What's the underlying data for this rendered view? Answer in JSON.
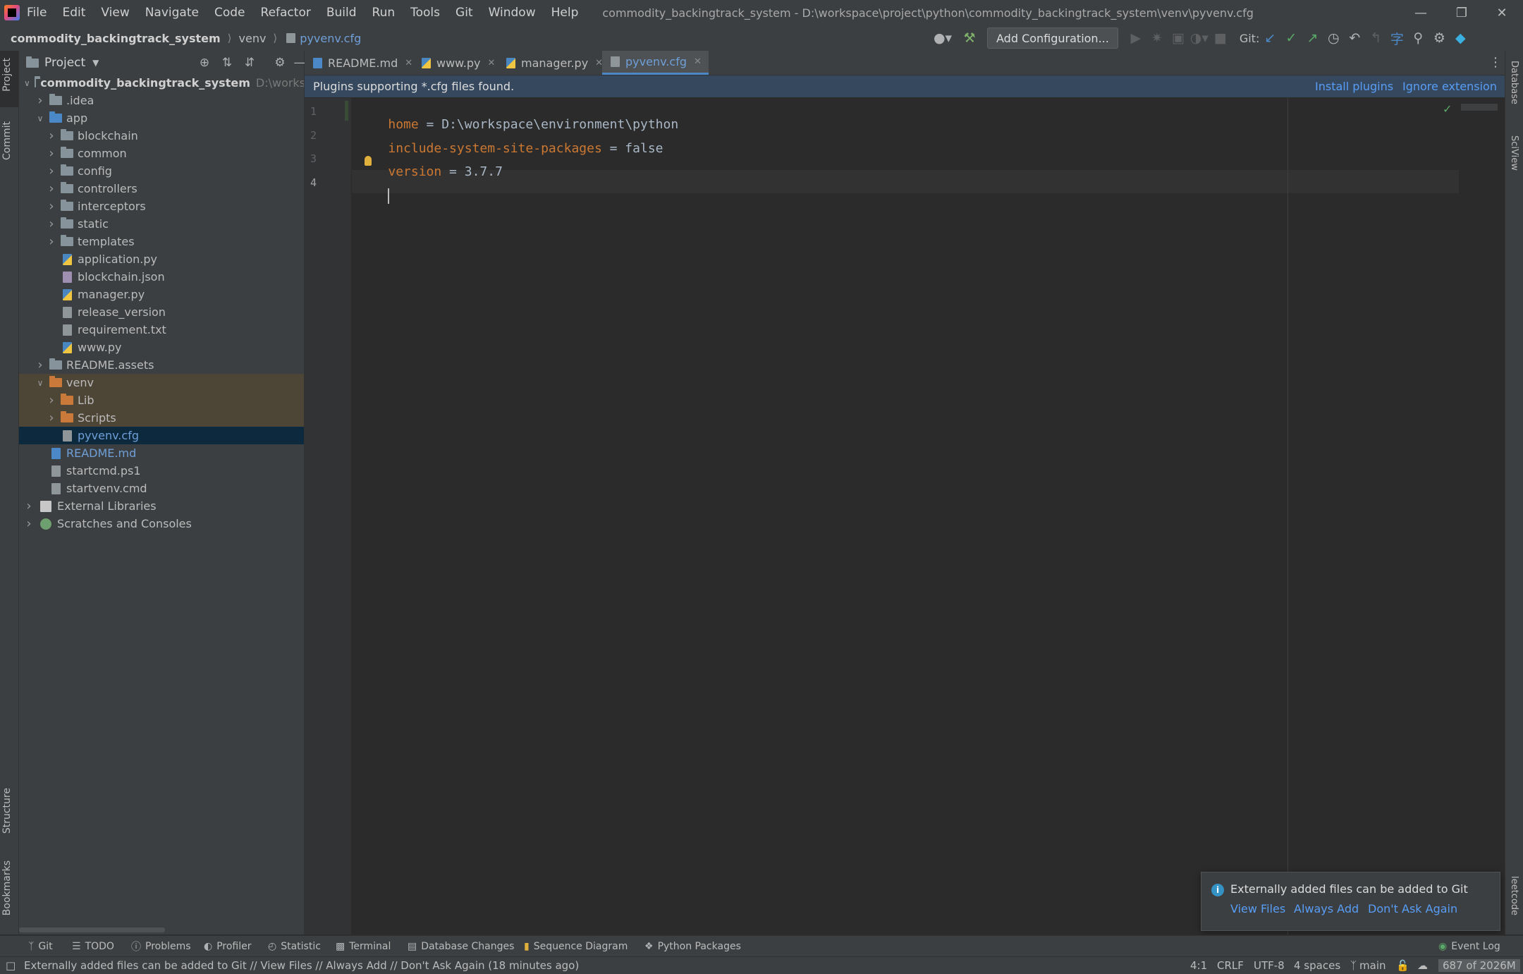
{
  "menu": {
    "items": [
      "File",
      "Edit",
      "View",
      "Navigate",
      "Code",
      "Refactor",
      "Build",
      "Run",
      "Tools",
      "Git",
      "Window",
      "Help"
    ],
    "window_title": "commodity_backingtrack_system - D:\\workspace\\project\\python\\commodity_backingtrack_system\\venv\\pyvenv.cfg"
  },
  "breadcrumb": [
    "commodity_backingtrack_system",
    "venv",
    "pyvenv.cfg"
  ],
  "toolbar": {
    "add_config": "Add Configuration...",
    "git_label": "Git:"
  },
  "left_strip": {
    "project": "Project",
    "commit": "Commit",
    "structure": "Structure",
    "bookmarks": "Bookmarks"
  },
  "right_strip": {
    "database": "Database",
    "sciview": "SciView",
    "leetcode": "leetcode"
  },
  "project_panel": {
    "title": "Project",
    "root_name": "commodity_backingtrack_system",
    "root_path": "D:\\workspace\\project\\python\\commodity_backingtrack_system",
    "tree": [
      {
        "label": ".idea",
        "depth": 1,
        "expand": "closed",
        "icon": "folder"
      },
      {
        "label": "app",
        "depth": 1,
        "expand": "open",
        "icon": "folder-blue"
      },
      {
        "label": "blockchain",
        "depth": 2,
        "expand": "closed",
        "icon": "folder"
      },
      {
        "label": "common",
        "depth": 2,
        "expand": "closed",
        "icon": "folder"
      },
      {
        "label": "config",
        "depth": 2,
        "expand": "closed",
        "icon": "folder"
      },
      {
        "label": "controllers",
        "depth": 2,
        "expand": "closed",
        "icon": "folder"
      },
      {
        "label": "interceptors",
        "depth": 2,
        "expand": "closed",
        "icon": "folder"
      },
      {
        "label": "static",
        "depth": 2,
        "expand": "closed",
        "icon": "folder"
      },
      {
        "label": "templates",
        "depth": 2,
        "expand": "closed",
        "icon": "folder"
      },
      {
        "label": "application.py",
        "depth": 2,
        "expand": "none",
        "icon": "py"
      },
      {
        "label": "blockchain.json",
        "depth": 2,
        "expand": "none",
        "icon": "json"
      },
      {
        "label": "manager.py",
        "depth": 2,
        "expand": "none",
        "icon": "py"
      },
      {
        "label": "release_version",
        "depth": 2,
        "expand": "none",
        "icon": "file"
      },
      {
        "label": "requirement.txt",
        "depth": 2,
        "expand": "none",
        "icon": "file"
      },
      {
        "label": "www.py",
        "depth": 2,
        "expand": "none",
        "icon": "py"
      },
      {
        "label": "README.assets",
        "depth": 1,
        "expand": "closed",
        "icon": "folder"
      },
      {
        "label": "venv",
        "depth": 1,
        "expand": "open",
        "icon": "folder-orange"
      },
      {
        "label": "Lib",
        "depth": 2,
        "expand": "closed",
        "icon": "folder-orange"
      },
      {
        "label": "Scripts",
        "depth": 2,
        "expand": "closed",
        "icon": "folder-orange"
      },
      {
        "label": "pyvenv.cfg",
        "depth": 2,
        "expand": "none",
        "icon": "file"
      },
      {
        "label": "README.md",
        "depth": 1,
        "expand": "none",
        "icon": "md"
      },
      {
        "label": "startcmd.ps1",
        "depth": 1,
        "expand": "none",
        "icon": "file"
      },
      {
        "label": "startvenv.cmd",
        "depth": 1,
        "expand": "none",
        "icon": "file"
      },
      {
        "label": "External Libraries",
        "depth": 0,
        "expand": "closed",
        "icon": "lib"
      },
      {
        "label": "Scratches and Consoles",
        "depth": 0,
        "expand": "closed",
        "icon": "scratch"
      }
    ]
  },
  "tabs": [
    {
      "label": "README.md",
      "icon": "md",
      "active": false
    },
    {
      "label": "www.py",
      "icon": "py",
      "active": false
    },
    {
      "label": "manager.py",
      "icon": "py",
      "active": false
    },
    {
      "label": "pyvenv.cfg",
      "icon": "file",
      "active": true
    }
  ],
  "banner": {
    "message": "Plugins supporting *.cfg files found.",
    "install": "Install plugins",
    "ignore": "Ignore extension"
  },
  "editor": {
    "line_numbers": [
      "1",
      "2",
      "3",
      "4"
    ],
    "lines": [
      {
        "key": "home",
        "rest": " = D:\\workspace\\environment\\python"
      },
      {
        "key": "include-system-site-packages",
        "rest": " = false"
      },
      {
        "key": "version",
        "rest": " = 3.7.7"
      },
      {
        "key": "",
        "rest": ""
      }
    ]
  },
  "notification": {
    "text": "Externally added files can be added to Git",
    "view_files": "View Files",
    "always_add": "Always Add",
    "dont_ask": "Don't Ask Again"
  },
  "bottom_tools": [
    "Git",
    "TODO",
    "Problems",
    "Profiler",
    "Statistic",
    "Terminal",
    "Database Changes",
    "Sequence Diagram",
    "Python Packages",
    "Event Log"
  ],
  "status": {
    "message": "Externally added files can be added to Git // View Files // Always Add // Don't Ask Again (18 minutes ago)",
    "position": "4:1",
    "line_sep": "CRLF",
    "encoding": "UTF-8",
    "indent": "4 spaces",
    "branch": "main",
    "memory": "687 of 2026M"
  },
  "colors": {
    "accent": "#4a88c7",
    "keyword": "#cc7832",
    "link": "#589df6",
    "selection": "#0d293e",
    "venv_highlight": "#4d4536"
  }
}
